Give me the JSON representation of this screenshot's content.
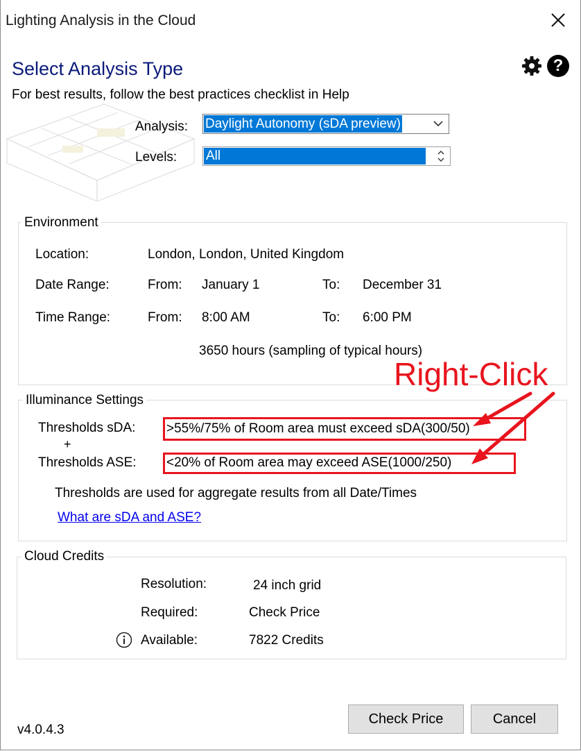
{
  "window": {
    "title": "Lighting Analysis in the Cloud"
  },
  "header": {
    "heading": "Select Analysis Type",
    "subtitle": "For best results, follow the best practices checklist in Help",
    "help_glyph": "?"
  },
  "form": {
    "analysis_label": "Analysis:",
    "analysis_value": "Daylight Autonomy (sDA preview)",
    "levels_label": "Levels:",
    "levels_value": "All"
  },
  "environment": {
    "title": "Environment",
    "location_label": "Location:",
    "location_value": "London, London, United Kingdom",
    "date_label": "Date Range:",
    "date_from_label": "From:",
    "date_from": "January 1",
    "date_to_label": "To:",
    "date_to": "December 31",
    "time_label": "Time Range:",
    "time_from_label": "From:",
    "time_from": "8:00 AM",
    "time_to_label": "To:",
    "time_to": "6:00 PM",
    "hours_text": "3650 hours (sampling of typical hours)"
  },
  "illuminance": {
    "title": "Illuminance Settings",
    "sda_label": "Thresholds sDA:",
    "plus": "+",
    "sda_value": ">55%/75% of Room area must exceed sDA(300/50)",
    "ase_label": "Thresholds ASE:",
    "ase_value": "<20% of Room area may exceed ASE(1000/250)",
    "note": "Thresholds are used for aggregate results from all Date/Times",
    "link": "What are sDA and ASE?"
  },
  "annotation": {
    "text": "Right-Click",
    "color": "#e8141e"
  },
  "credits": {
    "title": "Cloud Credits",
    "resolution_label": "Resolution:",
    "resolution_value": "24 inch grid",
    "required_label": "Required:",
    "required_value": "Check Price",
    "available_label": "Available:",
    "available_value": "7822 Credits"
  },
  "footer": {
    "version": "v4.0.4.3",
    "check_price_button": "Check Price",
    "cancel_button": "Cancel"
  },
  "colors": {
    "heading": "#0a1a7a",
    "selection": "#0078d7",
    "link": "#0000ee"
  },
  "icons": [
    "close-icon",
    "gear-icon",
    "help-icon",
    "chevron-down-icon",
    "spinner-icon",
    "info-icon"
  ]
}
